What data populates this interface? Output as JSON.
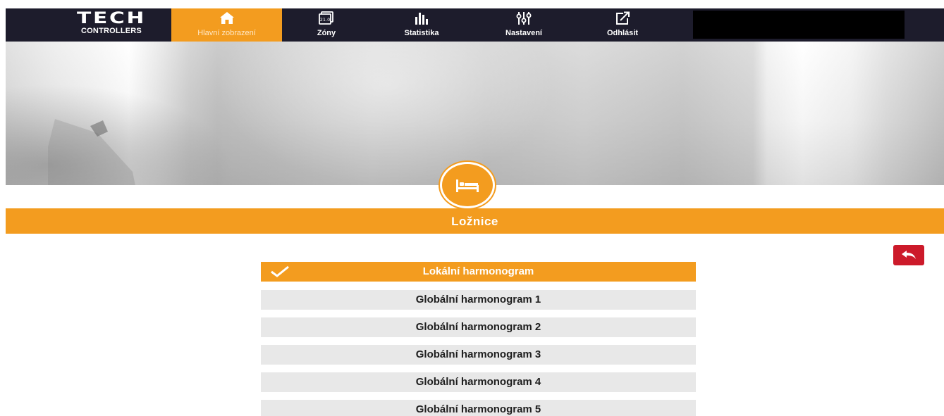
{
  "brand": {
    "logo_mark": "TECH",
    "logo_sub": "CONTROLLERS"
  },
  "nav": {
    "items": [
      {
        "label": "Hlavní zobrazení",
        "icon": "home-icon",
        "active": true
      },
      {
        "label": "Zóny",
        "icon": "zone-display-icon",
        "icon_text": "21.0",
        "active": false
      },
      {
        "label": "Statistika",
        "icon": "bar-chart-icon",
        "active": false
      },
      {
        "label": "Nastavení",
        "icon": "sliders-icon",
        "active": false
      },
      {
        "label": "Odhlásit",
        "icon": "logout-icon",
        "active": false
      }
    ]
  },
  "zone": {
    "title": "Ložnice",
    "icon": "bed-icon"
  },
  "back_button": {
    "icon": "back-arrow-icon"
  },
  "schedules": {
    "items": [
      {
        "label": "Lokální harmonogram",
        "selected": true
      },
      {
        "label": "Globální harmonogram 1",
        "selected": false
      },
      {
        "label": "Globální harmonogram 2",
        "selected": false
      },
      {
        "label": "Globální harmonogram 3",
        "selected": false
      },
      {
        "label": "Globální harmonogram 4",
        "selected": false
      },
      {
        "label": "Globální harmonogram 5",
        "selected": false
      }
    ]
  },
  "colors": {
    "nav_background": "#1d1c2c",
    "accent": "#f39c1f",
    "back_button": "#cc1a2a",
    "list_item": "#e8e8e8"
  }
}
